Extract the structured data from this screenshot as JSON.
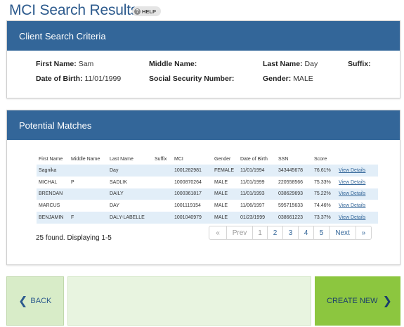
{
  "header": {
    "title": "MCI Search Results",
    "help": "HELP"
  },
  "criteria": {
    "title": "Client Search Criteria",
    "first_name_label": "First Name:",
    "first_name": "Sam",
    "middle_name_label": "Middle Name:",
    "middle_name": "",
    "last_name_label": "Last Name:",
    "last_name": "Day",
    "suffix_label": "Suffix:",
    "suffix": "",
    "dob_label": "Date of Birth:",
    "dob": "11/01/1999",
    "ssn_label": "Social Security Number:",
    "ssn": "",
    "gender_label": "Gender:",
    "gender": "MALE"
  },
  "matches": {
    "title": "Potential Matches",
    "columns": [
      "First Name",
      "Middle Name",
      "Last Name",
      "Suffix",
      "MCI",
      "Gender",
      "Date of Birth",
      "SSN",
      "Score",
      ""
    ],
    "rows": [
      {
        "first": "Sagnika",
        "middle": "",
        "last": "Day",
        "suffix": "",
        "mci": "1001282981",
        "gender": "FEMALE",
        "dob": "11/01/1994",
        "ssn": "343445678",
        "score": "76.61%",
        "link": "View Details"
      },
      {
        "first": "MICHAL",
        "middle": "P",
        "last": "SADLIK",
        "suffix": "",
        "mci": "1000870264",
        "gender": "MALE",
        "dob": "11/01/1999",
        "ssn": "220558566",
        "score": "75.33%",
        "link": "View Details"
      },
      {
        "first": "BRENDAN",
        "middle": "",
        "last": "DAILY",
        "suffix": "",
        "mci": "1000361817",
        "gender": "MALE",
        "dob": "11/01/1993",
        "ssn": "038629693",
        "score": "75.22%",
        "link": "View Details"
      },
      {
        "first": "MARCUS",
        "middle": "",
        "last": "DAY",
        "suffix": "",
        "mci": "1001119154",
        "gender": "MALE",
        "dob": "11/06/1997",
        "ssn": "595715633",
        "score": "74.46%",
        "link": "View Details"
      },
      {
        "first": "BENJAMIN",
        "middle": "F",
        "last": "DALY-LABELLE",
        "suffix": "",
        "mci": "1001040979",
        "gender": "MALE",
        "dob": "01/23/1999",
        "ssn": "038661223",
        "score": "73.37%",
        "link": "View Details"
      }
    ],
    "count_text": "25 found. Displaying 1-5",
    "pager": {
      "first": "«",
      "prev": "Prev",
      "p1": "1",
      "p2": "2",
      "p3": "3",
      "p4": "4",
      "p5": "5",
      "next": "Next",
      "last": "»"
    }
  },
  "footer": {
    "back": "BACK",
    "create": "CREATE NEW"
  },
  "icons": {
    "back": "chevron-left-icon",
    "create": "chevron-right-icon",
    "help": "help-icon"
  }
}
